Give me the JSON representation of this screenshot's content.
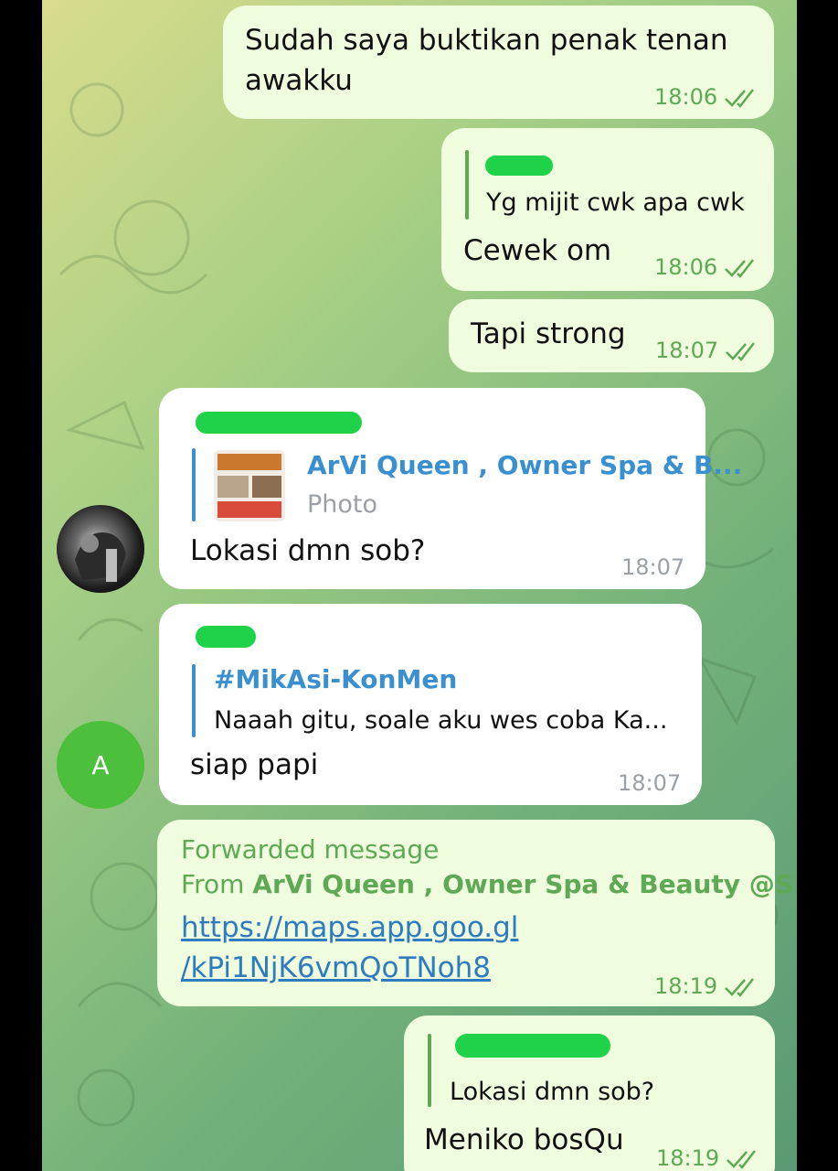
{
  "messages": {
    "m1": {
      "text_line1": "Sudah saya buktikan penak tenan",
      "text_line2": "awakku",
      "time": "18:06"
    },
    "m2": {
      "quote": "Yg mijit cwk apa cwk",
      "text": "Cewek om",
      "time": "18:06"
    },
    "m3": {
      "text": "Tapi strong",
      "time": "18:07"
    },
    "m4": {
      "reply_name": "ArVi Queen , Owner Spa & B...",
      "reply_sub": "Photo",
      "text": "Lokasi dmn sob?",
      "time": "18:07"
    },
    "m5": {
      "reply_name": "#MikAsi-KonMen",
      "reply_sub": "Naaah gitu, soale aku wes coba Ka...",
      "text": "siap papi",
      "time": "18:07",
      "avatar_letter": "A"
    },
    "m6": {
      "forwarded": "Forwarded message",
      "from_prefix": "From ",
      "from_name": "ArVi Queen , Owner Spa & Beauty @S...",
      "link_line1": "https://maps.app.goo.gl",
      "link_line2": "/kPi1NjK6vmQoTNoh8",
      "time": "18:19"
    },
    "m7": {
      "quote": "Lokasi dmn sob?",
      "text": "Meniko bosQu",
      "time": "18:19"
    }
  },
  "colors": {
    "outgoing": "#effdde",
    "incoming": "#ffffff",
    "accent_green": "#5fa855",
    "accent_blue": "#3a8fd0",
    "redaction": "#1fd24a",
    "avatar_a": "#4cbf3c"
  }
}
